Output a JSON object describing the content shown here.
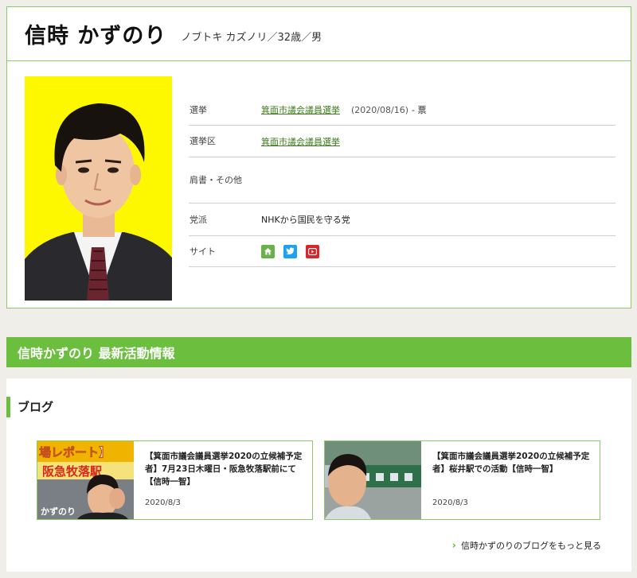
{
  "profile": {
    "name": "信時 かずのり",
    "reading": "ノブトキ カズノリ／32歳／男",
    "rows": {
      "election_label": "選挙",
      "election_value": "箕面市議会議員選挙",
      "election_date": "(2020/08/16)",
      "election_votes": "- 票",
      "district_label": "選挙区",
      "district_value": "箕面市議会議員選挙",
      "title_label": "肩書・その他",
      "title_value": "",
      "party_label": "党派",
      "party_value": "NHKから国民を守る党",
      "site_label": "サイト"
    },
    "icons": [
      "home-icon",
      "twitter-icon",
      "youtube-icon"
    ]
  },
  "colors": {
    "accent": "#6cbf3e",
    "border": "#8fca6a",
    "photo_bg": "#fdf700",
    "link": "#3f7a1e"
  },
  "activity": {
    "header": "信時かずのり 最新活動情報"
  },
  "blog": {
    "title": "ブログ",
    "posts": [
      {
        "title": "【箕面市議会議員選挙2020の立候補予定者】7月23日木曜日・阪急牧落駅前にて【信時一智】",
        "date": "2020/8/3",
        "thumb_text_top": "場レポート】",
        "thumb_text_mid": "阪急牧落駅",
        "thumb_caption": "かずのり"
      },
      {
        "title": "【箕面市議会議員選挙2020の立候補予定者】桜井駅での活動【信時一智】",
        "date": "2020/8/3"
      }
    ],
    "more_label": "信時かずのりのブログをもっと見る"
  }
}
